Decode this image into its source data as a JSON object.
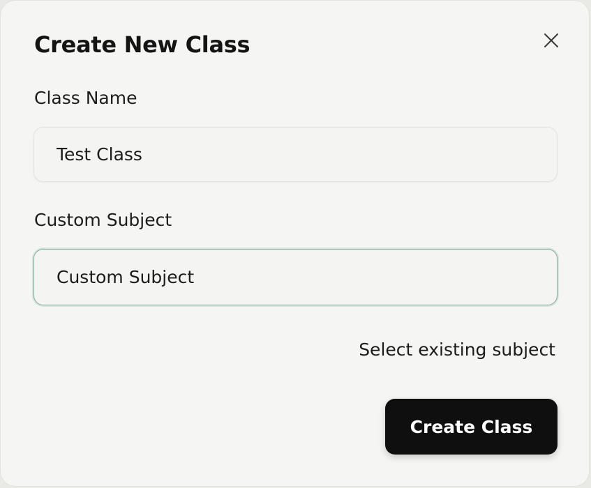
{
  "dialog": {
    "title": "Create New Class",
    "close_icon": "close-icon"
  },
  "fields": {
    "class_name": {
      "label": "Class Name",
      "value": "Test Class"
    },
    "custom_subject": {
      "label": "Custom Subject",
      "value": "",
      "placeholder": "Custom Subject"
    }
  },
  "toggle_link": "Select existing subject",
  "submit_label": "Create Class",
  "colors": {
    "background": "#f5f5f3",
    "primary_button": "#0f0f0f",
    "focus_ring": "#8aa99a"
  }
}
